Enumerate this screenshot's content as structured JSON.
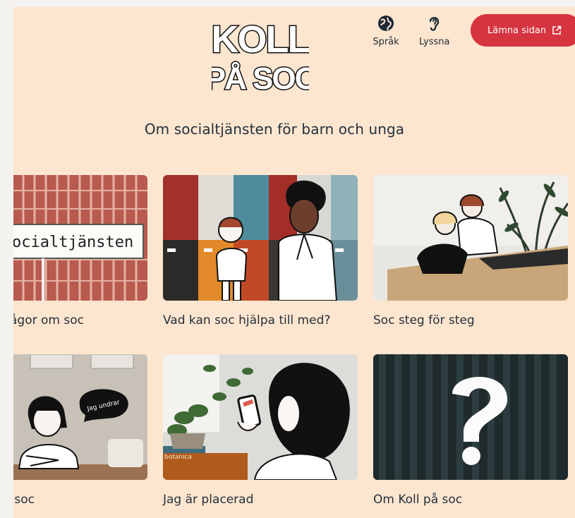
{
  "header": {
    "logo_line1": "KOLL",
    "logo_line2": "PÅ SOC",
    "language_label": "Språk",
    "listen_label": "Lyssna",
    "leave_label": "Lämna sidan"
  },
  "main": {
    "title": "Om socialtjänsten för barn och unga",
    "cards": [
      {
        "caption": "Frågor om soc",
        "sign_text": "ocialtjänsten"
      },
      {
        "caption": "Vad kan soc hjälpa till med?"
      },
      {
        "caption": "Soc steg för steg"
      },
      {
        "caption": "Jag undrar soc",
        "bubble_text": "Jag undrar"
      },
      {
        "caption": "Jag är placerad",
        "book_text": "botanica"
      },
      {
        "caption": "Om Koll på soc"
      }
    ]
  },
  "colors": {
    "page_bg": "#fde6cf",
    "outer_bg": "#f3f2ee",
    "accent": "#d6343f",
    "text": "#24303c"
  }
}
